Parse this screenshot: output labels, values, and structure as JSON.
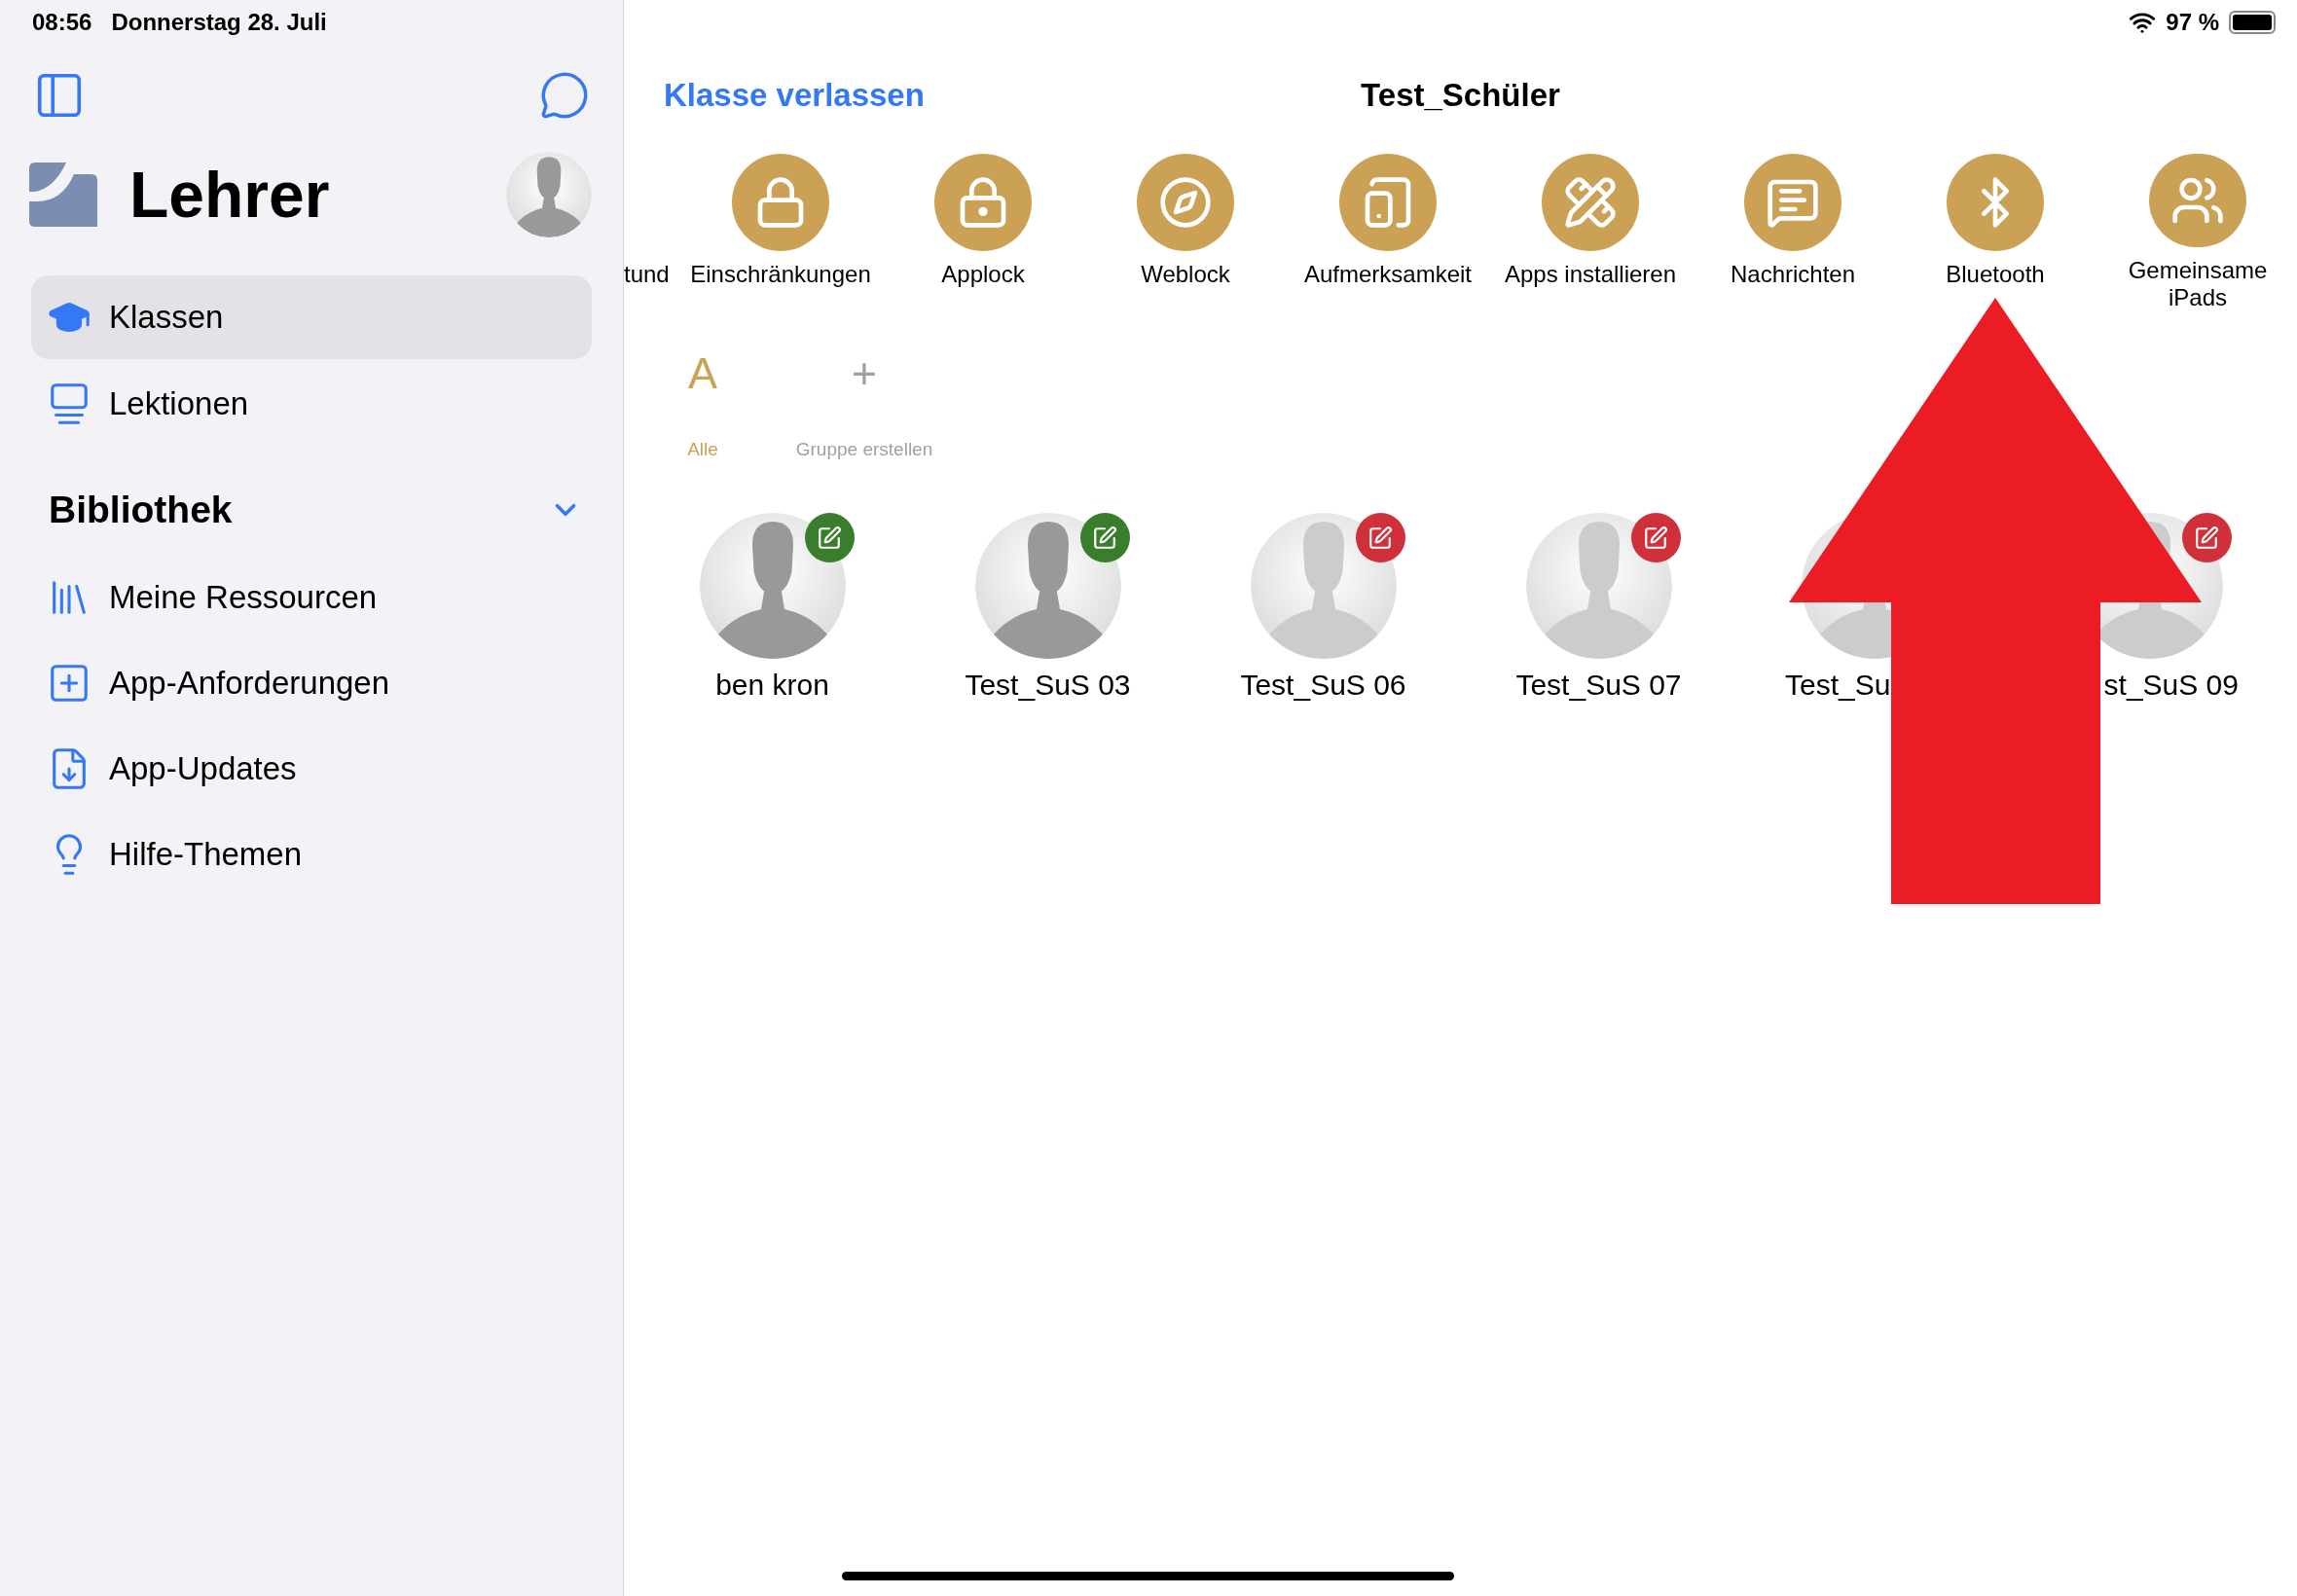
{
  "status_bar": {
    "time": "08:56",
    "date": "Donnerstag 28. Juli",
    "battery": "97 %"
  },
  "sidebar": {
    "title": "Lehrer",
    "nav_items": [
      {
        "label": "Klassen",
        "selected": true
      },
      {
        "label": "Lektionen",
        "selected": false
      }
    ],
    "library": {
      "title": "Bibliothek",
      "expanded": true,
      "items": [
        {
          "label": "Meine Ressourcen"
        },
        {
          "label": "App-Anforderungen"
        },
        {
          "label": "App-Updates"
        },
        {
          "label": "Hilfe-Themen"
        }
      ]
    }
  },
  "header": {
    "back_link": "Klasse verlassen",
    "title": "Test_Schüler"
  },
  "actions": [
    {
      "label": "tund",
      "kind": "partial"
    },
    {
      "label": "Einschränkungen",
      "kind": "lock"
    },
    {
      "label": "Applock",
      "kind": "applock"
    },
    {
      "label": "Weblock",
      "kind": "compass"
    },
    {
      "label": "Aufmerksamkeit",
      "kind": "attention"
    },
    {
      "label": "Apps installieren",
      "kind": "appstore"
    },
    {
      "label": "Nachrichten",
      "kind": "messages"
    },
    {
      "label": "Bluetooth",
      "kind": "bluetooth"
    },
    {
      "label": "Gemeinsame iPads",
      "kind": "shared"
    }
  ],
  "groups": [
    {
      "symbol": "A",
      "label": "Alle",
      "selected": true
    },
    {
      "symbol": "+",
      "label": "Gruppe erstellen",
      "selected": false
    }
  ],
  "students": [
    {
      "name": "ben kron",
      "kind": "whole",
      "online": true,
      "color": "#3a7d2c"
    },
    {
      "name": "Test_SuS 03",
      "kind": "whole",
      "online": true,
      "color": "#3a7d2c"
    },
    {
      "name": "Test_SuS 06",
      "kind": "whole",
      "online": false,
      "color": "#d0303a"
    },
    {
      "name": "Test_SuS 07",
      "kind": "whole",
      "online": false,
      "color": "#d0303a"
    },
    {
      "name": "Test_Su",
      "kind": "cut_end",
      "online": false
    },
    {
      "name": "st_SuS 09",
      "kind": "cut_start",
      "online": false,
      "color": "#d0303a"
    }
  ],
  "annotation": {
    "kind": "up_arrow"
  }
}
